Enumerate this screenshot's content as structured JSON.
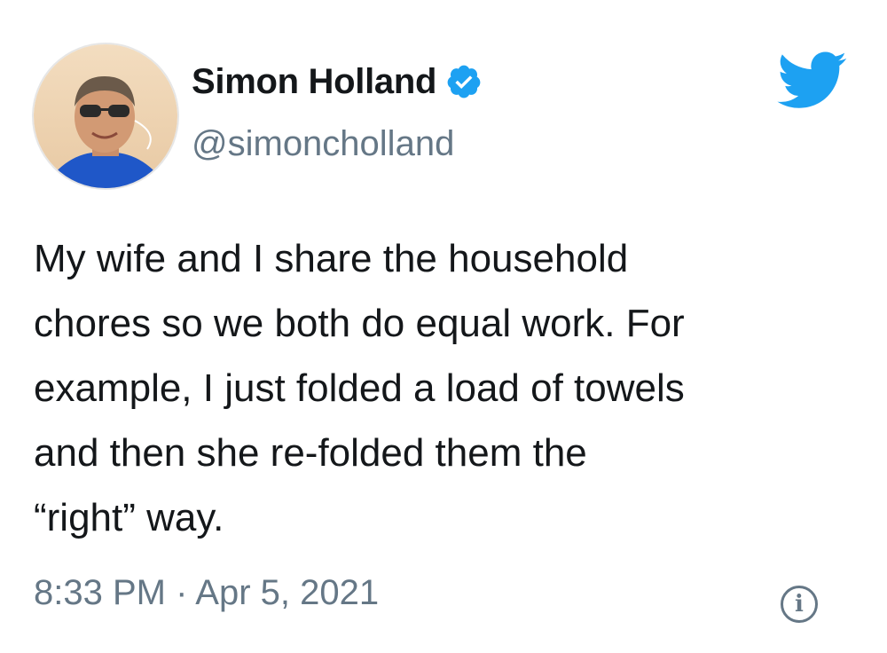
{
  "tweet": {
    "author": {
      "display_name": "Simon Holland",
      "handle": "@simoncholland",
      "verified": true
    },
    "text": "My wife and I share the household\nchores so we both do equal work. For\nexample, I just folded a load of towels\nand then she re-folded them the\n“right” way.",
    "timestamp": "8:33 PM · Apr 5, 2021",
    "info_icon": "i"
  },
  "icons": {
    "verified": "verified-badge-icon",
    "platform": "twitter-bird-icon",
    "info": "info-icon"
  },
  "colors": {
    "brand_blue": "#1da1f2",
    "text_primary": "#14171a",
    "text_secondary": "#657786",
    "background": "#ffffff"
  }
}
